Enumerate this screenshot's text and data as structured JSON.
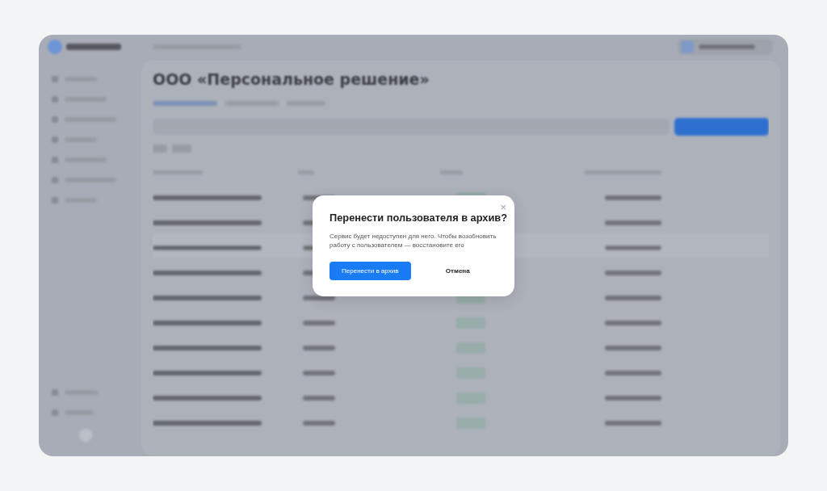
{
  "page": {
    "title": "ООО «Персональное решение»"
  },
  "dialog": {
    "title": "Перенести пользователя в архив?",
    "close": "×",
    "message": "Сервис будет недоступен для него. Чтобы возобновить работу с пользователем — восстановите его",
    "buttons": [
      {
        "label": "Перенести в архив",
        "kind": "primary"
      },
      {
        "label": "Отмена",
        "kind": "secondary"
      }
    ]
  }
}
